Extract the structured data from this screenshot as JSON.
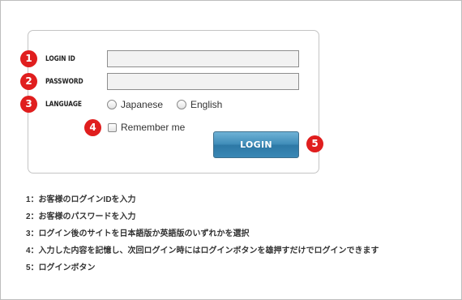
{
  "form": {
    "login_id": {
      "label": "LOGIN ID",
      "value": ""
    },
    "password": {
      "label": "PASSWORD",
      "value": ""
    },
    "language": {
      "label": "LANGUAGE",
      "options": [
        "Japanese",
        "English"
      ],
      "selected": null
    },
    "remember_me": {
      "label": "Remember me",
      "checked": false
    },
    "login_button": "LOGIN"
  },
  "badges": [
    "1",
    "2",
    "3",
    "4",
    "5"
  ],
  "badge_color": "#e01e1e",
  "button_color": "#3f8cb8",
  "notes": [
    "1：お客様のログインIDを入力",
    "2：お客様のパスワードを入力",
    "3：ログイン後のサイトを日本語版か英語版のいずれかを選択",
    "4：入力した内容を記憶し、次回ログイン時にはログインボタンを雄押すだけでログインできます",
    "5：ログインボタン"
  ]
}
